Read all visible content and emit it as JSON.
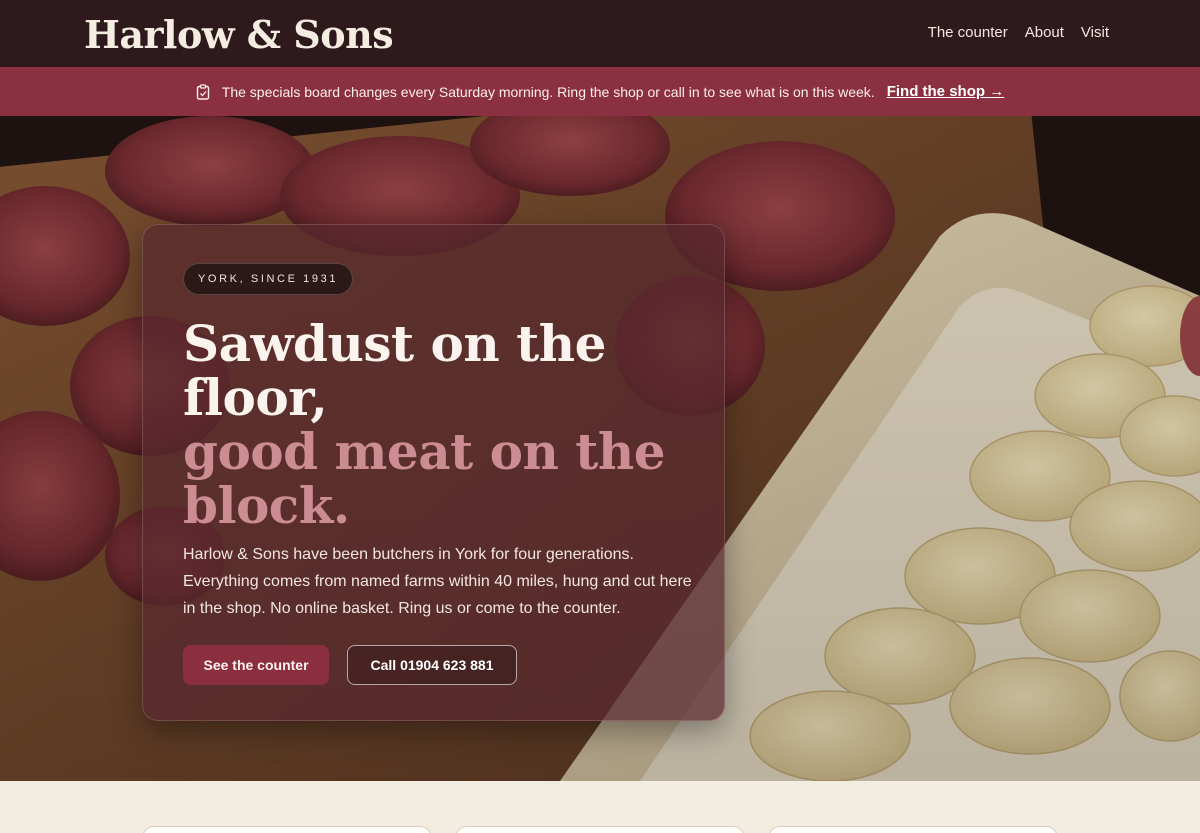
{
  "header": {
    "brand": "Harlow & Sons",
    "nav": [
      "The counter",
      "About",
      "Visit"
    ]
  },
  "notice": {
    "icon": "clipboard-icon",
    "text": "The specials board changes every Saturday morning. Ring the shop or call in to see what is on this week.",
    "link": "Find the shop →"
  },
  "hero": {
    "badge": "YORK, SINCE 1931",
    "headline_line1": "Sawdust on the floor,",
    "headline_line2": "good meat on the block.",
    "lede": "Harlow & Sons have been butchers in York for four generations. Everything comes from named farms within 40 miles, hung and cut here in the shop. No online basket. Ring us or come to the counter.",
    "primary_button": "See the counter",
    "secondary_button": "Call 01904 623 881"
  },
  "colors": {
    "header_bg": "#2e1a1d",
    "notice_bg": "#8b3040",
    "accent": "#8b2e3e",
    "headline_accent": "#cc8d92",
    "page_bg": "#f3ece1"
  }
}
